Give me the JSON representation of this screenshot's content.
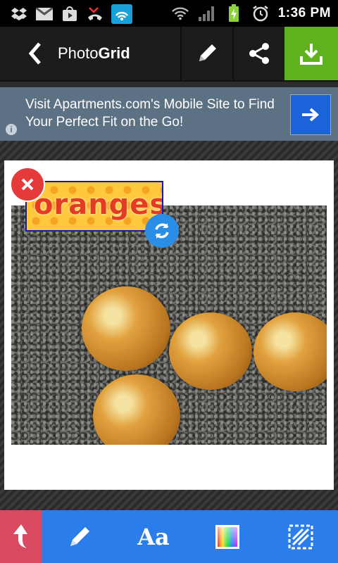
{
  "status_bar": {
    "time": "1:36 PM",
    "icons_left": [
      "dropbox-icon",
      "gmail-icon",
      "play-store-icon",
      "missed-call-icon",
      "wifi-app-icon"
    ],
    "icons_right": [
      "wifi-icon",
      "signal-icon",
      "battery-charging-icon",
      "alarm-icon"
    ]
  },
  "app_bar": {
    "title_prefix": "Photo",
    "title_bold": "Grid",
    "actions": [
      "edit-icon",
      "share-icon",
      "download-icon"
    ],
    "save_color": "#5fb21d"
  },
  "ad": {
    "text": "Visit Apartments.com's Mobile Site to Find Your Perfect Fit on the Go!",
    "info_glyph": "i",
    "button_icon": "arrow-right-icon"
  },
  "sticker": {
    "text": "oranges"
  },
  "toolbar": {
    "text_tool_label": "Aa",
    "tools": [
      "undo-icon",
      "brush-icon",
      "text-icon",
      "color-palette-icon",
      "frame-icon"
    ],
    "accent": "#2b7de9",
    "undo_color": "#d94a60"
  }
}
